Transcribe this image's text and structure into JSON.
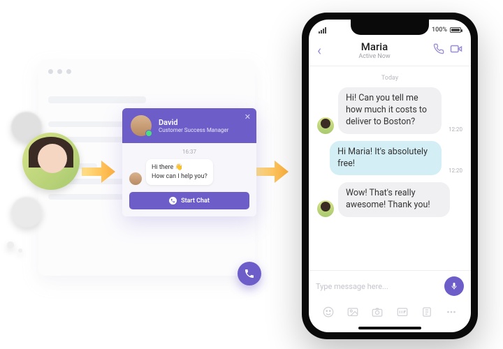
{
  "widget": {
    "agent_name": "David",
    "agent_role": "Customer Success Manager",
    "time": "16:37",
    "greeting_line1": "Hi there 👋",
    "greeting_line2": "How can I help you?",
    "start_chat_label": "Start Chat"
  },
  "phone": {
    "status": {
      "signal_count": 4,
      "battery_pct": "100%"
    },
    "header": {
      "contact_name": "Maria",
      "presence": "Active Now"
    },
    "day_separator": "Today",
    "messages": [
      {
        "side": "in",
        "text": "Hi! Can you tell me how much it costs to deliver to Boston?",
        "time": "12:20"
      },
      {
        "side": "out",
        "text": "Hi Maria! It's absolutely free!",
        "time": "12:20"
      },
      {
        "side": "in",
        "text": "Wow! That's really awesome! Thank you!",
        "time": ""
      }
    ],
    "compose_placeholder": "Type message here..."
  }
}
